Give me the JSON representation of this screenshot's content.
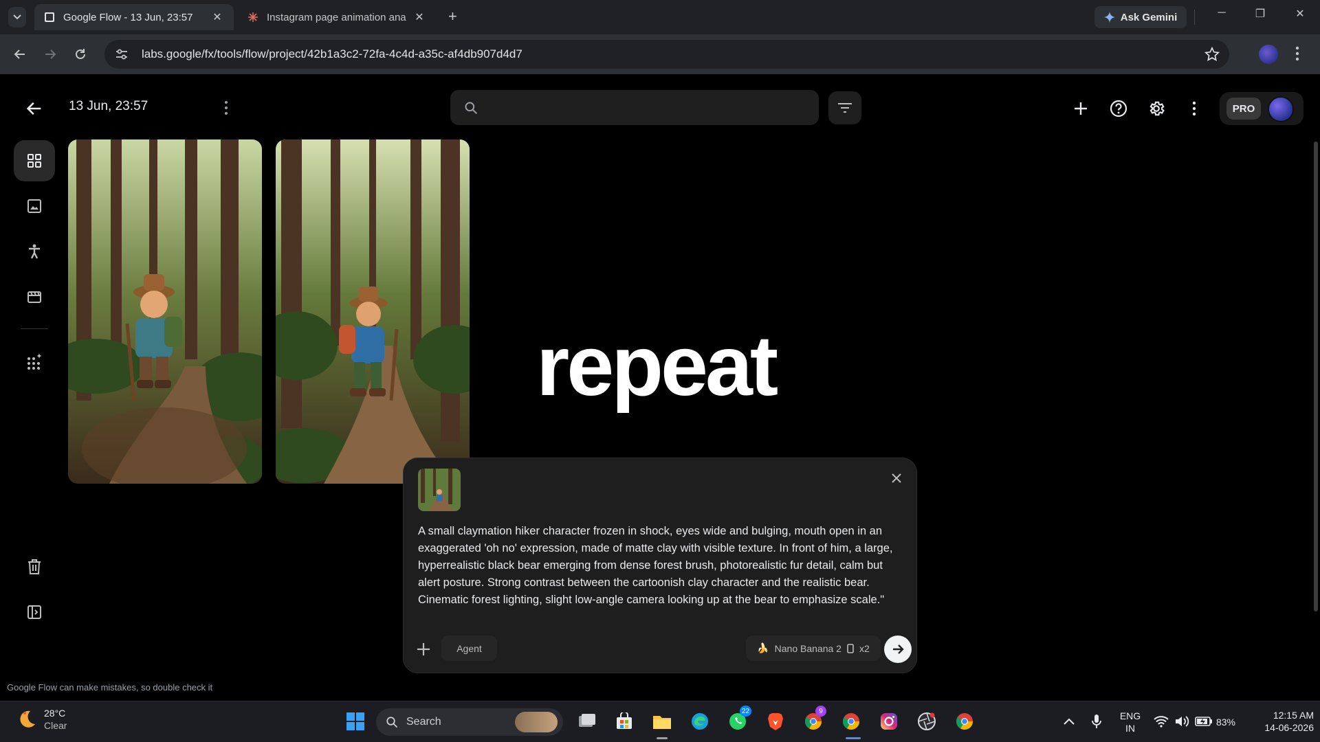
{
  "browser": {
    "tabs": [
      {
        "title": "Google Flow - 13 Jun, 23:57",
        "active": true
      },
      {
        "title": "Instagram page animation ana",
        "active": false
      }
    ],
    "ask_gemini_label": "Ask Gemini",
    "url": "labs.google/fx/tools/flow/project/42b1a3c2-72fa-4c4d-a35c-af4db907d4d7"
  },
  "app": {
    "project_title": "13 Jun, 23:57",
    "search_value": "",
    "pro_label": "PRO",
    "overlay_word": "repeat",
    "disclaimer": "Google Flow can make mistakes, so double check it"
  },
  "sidebar": {
    "items": [
      {
        "name": "grid-view",
        "icon": "grid-icon",
        "active": true
      },
      {
        "name": "images",
        "icon": "image-icon",
        "active": false
      },
      {
        "name": "characters",
        "icon": "person-icon",
        "active": false
      },
      {
        "name": "scenes",
        "icon": "clapperboard-icon",
        "active": false
      },
      {
        "name": "apps",
        "icon": "apps-sparkle-icon",
        "active": false
      },
      {
        "name": "trash",
        "icon": "trash-icon",
        "active": false
      },
      {
        "name": "panel-toggle",
        "icon": "side-panel-icon",
        "active": false
      }
    ]
  },
  "prompt": {
    "text": "A small claymation hiker character frozen in shock, eyes wide and bulging, mouth open in an exaggerated 'oh no' expression, made of matte clay with visible texture. In front of him, a large, hyperrealistic black bear emerging from dense forest brush, photorealistic fur detail, calm but alert posture. Strong contrast between the cartoonish clay character and the realistic bear. Cinematic forest lighting, slight low-angle camera looking up at the bear to emphasize scale.\"",
    "agent_label": "Agent",
    "model_label": "Nano Banana 2",
    "count_label": "x2"
  },
  "taskbar": {
    "weather_temp": "28°C",
    "weather_desc": "Clear",
    "search_label": "Search",
    "whatsapp_badge": "22",
    "chrome_badge": "9",
    "lang_line1": "ENG",
    "lang_line2": "IN",
    "battery": "83%",
    "time": "12:15 AM",
    "date": "14-06-2026"
  },
  "colors": {
    "background": "#000000",
    "surface": "#1e1e1e",
    "browser_chrome": "#2d3035",
    "taskbar": "#1b1d22",
    "accent_gemini": "#8ab4f8"
  }
}
